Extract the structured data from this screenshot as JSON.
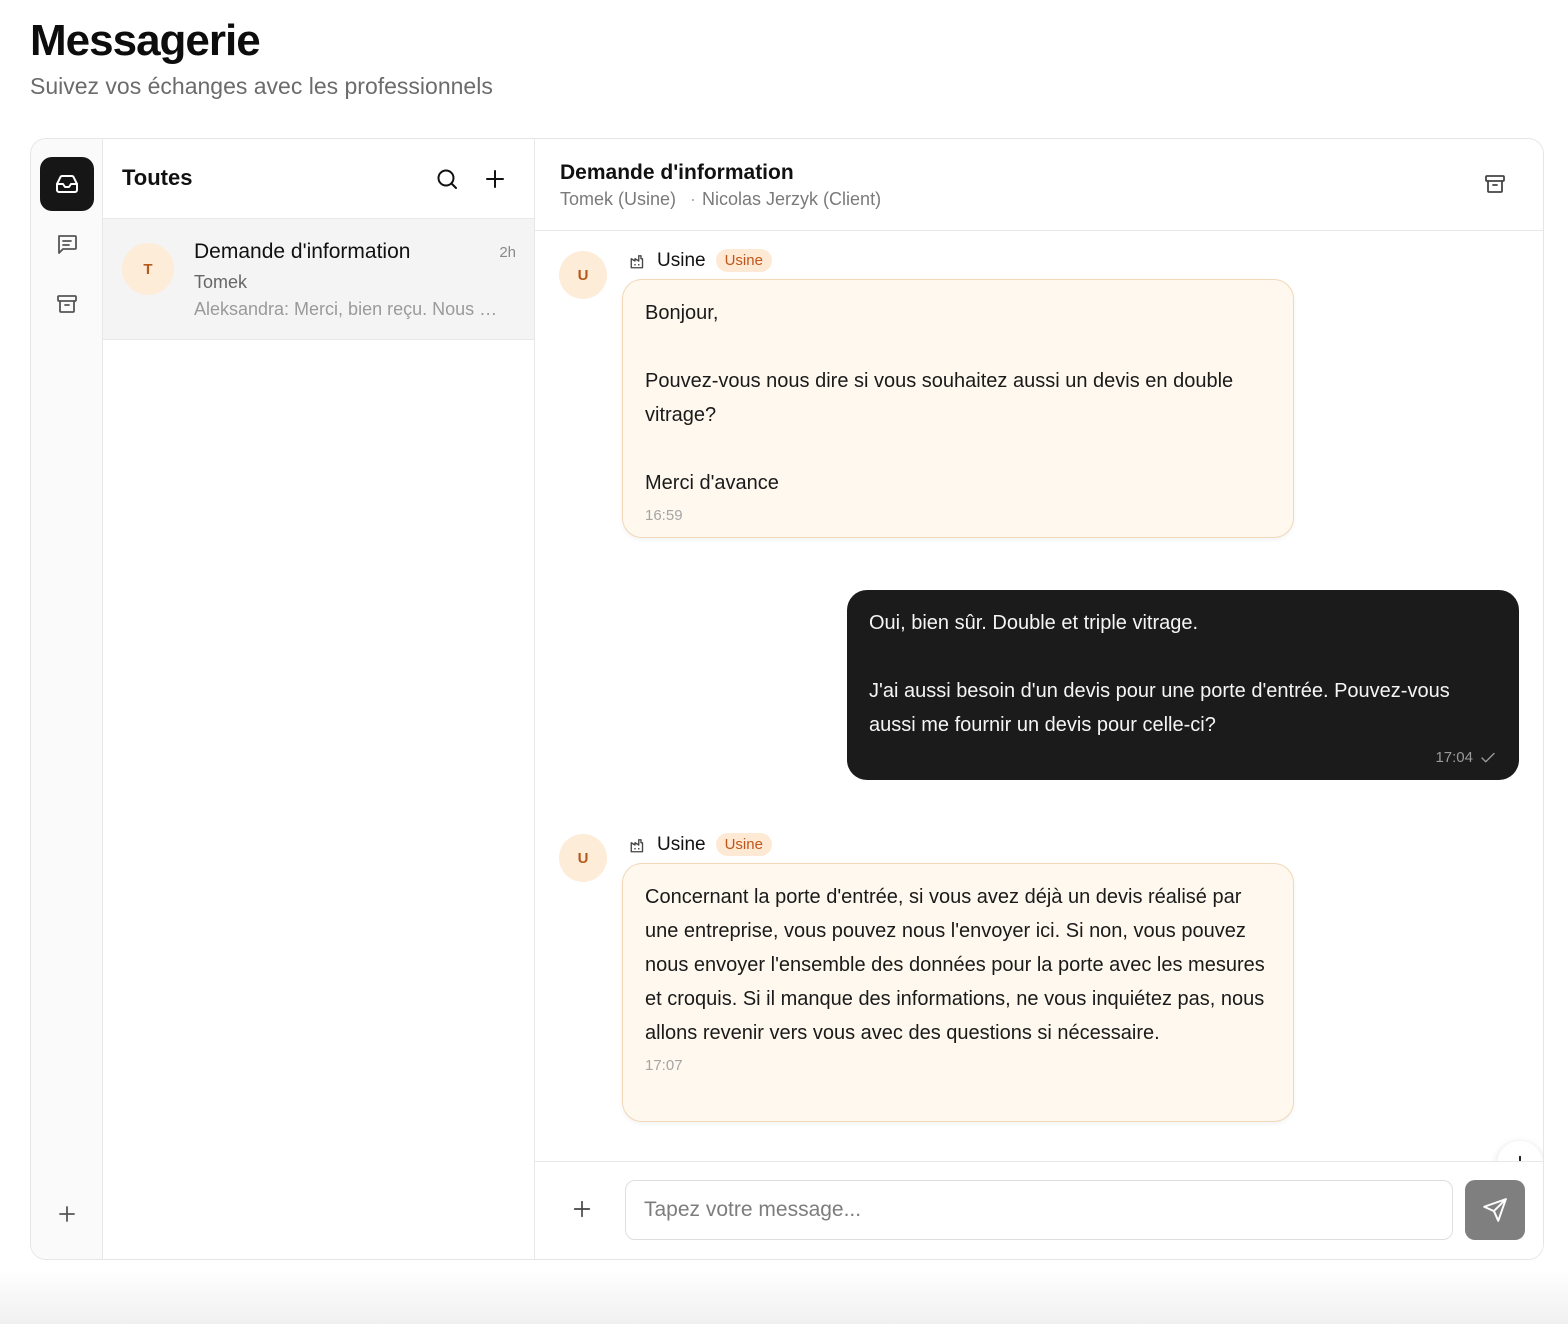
{
  "page": {
    "title": "Messagerie",
    "subtitle": "Suivez vos échanges avec les professionnels"
  },
  "rail": {
    "items": [
      {
        "icon": "inbox-icon",
        "active": true
      },
      {
        "icon": "chat-icon",
        "active": false
      },
      {
        "icon": "archive-icon",
        "active": false
      }
    ],
    "add_icon": "plus-icon"
  },
  "list": {
    "title": "Toutes",
    "conversations": [
      {
        "avatar": "T",
        "title": "Demande d'information",
        "time": "2h",
        "name": "Tomek",
        "preview": "Aleksandra: Merci, bien reçu. Nous …"
      }
    ]
  },
  "chat": {
    "title": "Demande d'information",
    "participants": [
      "Tomek (Usine)",
      "Nicolas Jerzyk (Client)"
    ],
    "messages": [
      {
        "direction": "in",
        "avatar": "U",
        "sender": "Usine",
        "badge": "Usine",
        "text": "Bonjour,\n\nPouvez-vous nous dire si vous souhaitez aussi un devis en double vitrage?\n\nMerci d'avance",
        "time": "16:59"
      },
      {
        "direction": "out",
        "text": "Oui, bien sûr. Double et triple vitrage.\n\nJ'ai aussi besoin d'un devis pour une porte d'entrée. Pouvez-vous aussi me fournir un devis pour celle-ci?",
        "time": "17:04"
      },
      {
        "direction": "in",
        "avatar": "U",
        "sender": "Usine",
        "badge": "Usine",
        "text": "Concernant la porte d'entrée, si vous avez déjà un devis réalisé par une entreprise, vous pouvez nous l'envoyer ici. Si non, vous pouvez nous envoyer l'ensemble des données pour la porte avec les mesures et croquis. Si il manque des informations, ne vous inquiétez pas, nous allons revenir vers vous avec des questions si nécessaire.",
        "time": "17:07"
      }
    ],
    "composer": {
      "placeholder": "Tapez votre message...",
      "value": ""
    }
  },
  "colors": {
    "accent_dark": "#1b1b1b",
    "incoming_bubble": "#fef8ee",
    "badge_text": "#c0561a",
    "badge_bg": "#fde9d4"
  }
}
